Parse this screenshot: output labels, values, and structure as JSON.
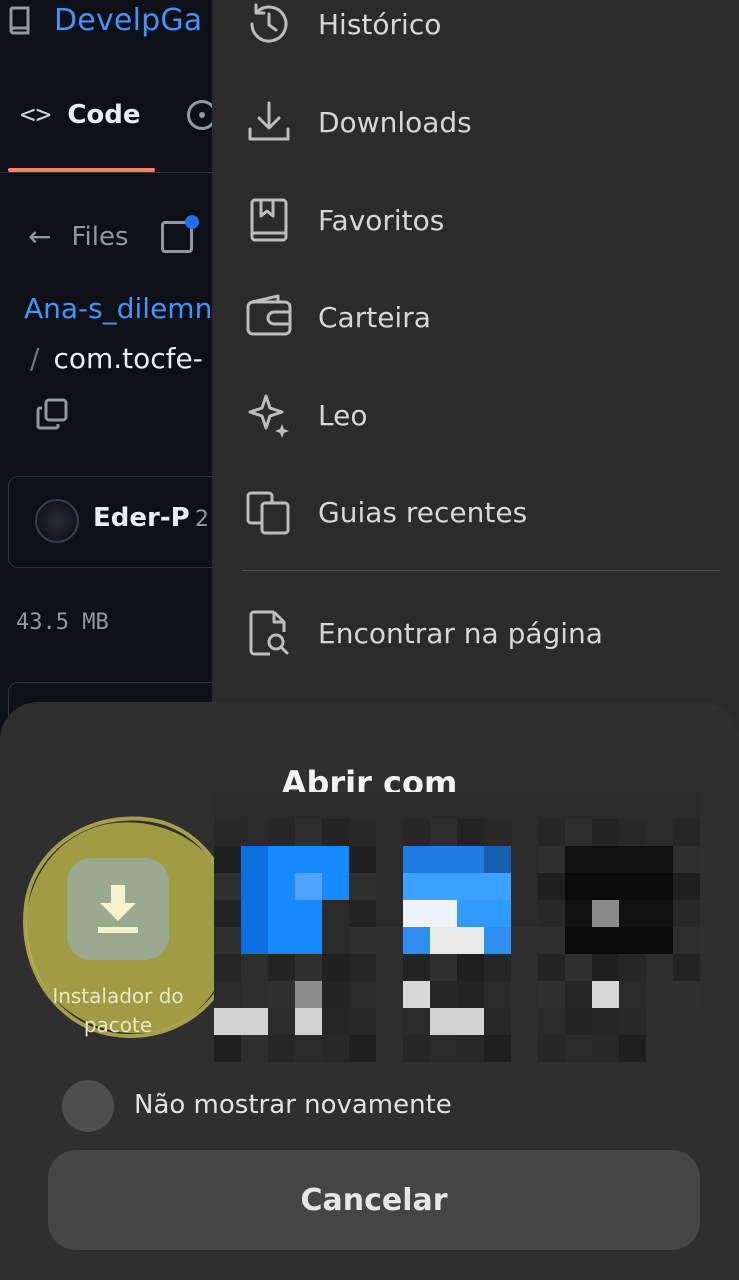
{
  "github": {
    "repo_name": "DevelpGa",
    "tab_code_icon": "<>",
    "tab_code_label": "Code",
    "back_icon": "←",
    "files_label": "Files",
    "breadcrumb_repo": "Ana-s_dilemn",
    "breadcrumb_slash": "/",
    "breadcrumb_file": "com.tocfe-",
    "commit_author": "Eder-P",
    "commit_meta": "2",
    "file_size": "43.5 MB"
  },
  "menu": {
    "items": [
      {
        "label": "Histórico",
        "icon": "history-icon"
      },
      {
        "label": "Downloads",
        "icon": "download-icon"
      },
      {
        "label": "Favoritos",
        "icon": "bookmark-icon"
      },
      {
        "label": "Carteira",
        "icon": "wallet-icon"
      },
      {
        "label": "Leo",
        "icon": "sparkle-icon"
      },
      {
        "label": "Guias recentes",
        "icon": "recent-tabs-icon"
      },
      {
        "label": "Encontrar na página",
        "icon": "find-in-page-icon"
      }
    ]
  },
  "sheet": {
    "title": "Abrir com",
    "apps": [
      {
        "label": "Instalador do pacote",
        "icon": "package-installer-download-icon"
      }
    ],
    "dont_show_again": "Não mostrar novamente",
    "cancel": "Cancelar"
  },
  "colors": {
    "page_bg": "#0d1117",
    "link_blue": "#4493f8",
    "tab_underline": "#f78166",
    "menu_bg": "#2b2b2b",
    "sheet_bg": "#2f2f2f",
    "highlight": "#a9a645",
    "installer_tile": "#9aaa8e",
    "cancel_bg": "#454545"
  }
}
